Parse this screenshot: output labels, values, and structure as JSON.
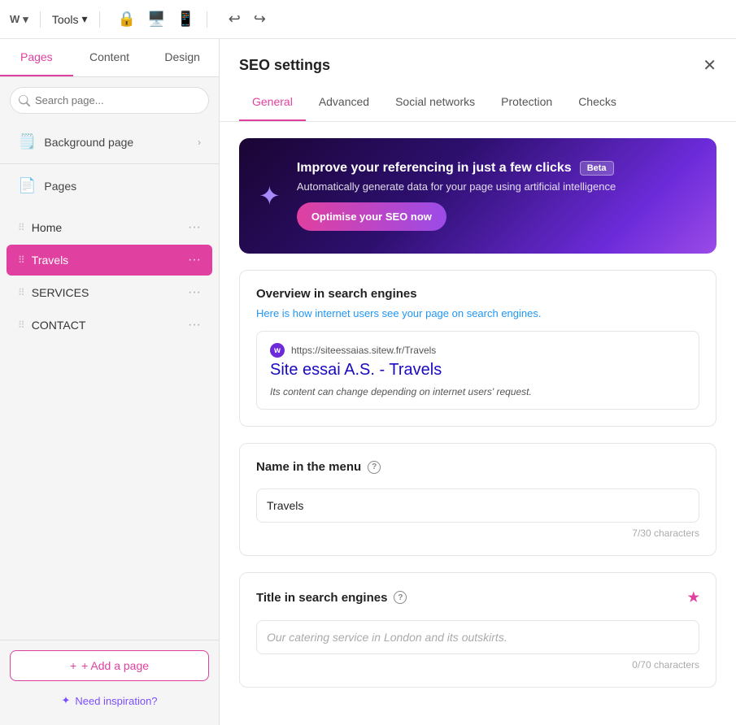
{
  "topbar": {
    "logo": "W",
    "tools_label": "Tools",
    "chevron": "▾"
  },
  "sidebar": {
    "tabs": [
      {
        "label": "Pages",
        "active": true
      },
      {
        "label": "Content",
        "active": false
      },
      {
        "label": "Design",
        "active": false
      }
    ],
    "search_placeholder": "Search page...",
    "background_page_label": "Background page",
    "pages_label": "Pages",
    "nav_items": [
      {
        "name": "Home",
        "active": false
      },
      {
        "name": "Travels",
        "active": true
      },
      {
        "name": "SERVICES",
        "active": false
      },
      {
        "name": "CONTACT",
        "active": false
      }
    ],
    "add_page_label": "+ Add a page",
    "inspiration_label": "Need inspiration?"
  },
  "seo": {
    "title": "SEO settings",
    "tabs": [
      {
        "label": "General",
        "active": true
      },
      {
        "label": "Advanced",
        "active": false
      },
      {
        "label": "Social networks",
        "active": false
      },
      {
        "label": "Protection",
        "active": false
      },
      {
        "label": "Checks",
        "active": false
      }
    ],
    "ai_banner": {
      "title": "Improve your referencing in just a few clicks",
      "badge": "Beta",
      "description": "Automatically generate data for your page using artificial intelligence",
      "button_label": "Optimise your SEO now"
    },
    "overview": {
      "title": "Overview in search engines",
      "subtitle": "Here is how internet users see your page on search engines.",
      "url": "https://siteessaias.sitew.fr/Travels",
      "site_name": "Site essai A.S. - Travels",
      "italic_note": "Its content can change depending on internet users' request."
    },
    "menu_name": {
      "title": "Name in the menu",
      "value": "Travels",
      "char_count": "7/30 characters"
    },
    "title_section": {
      "title": "Title in search engines",
      "placeholder": "Our catering service in London and its outskirts.",
      "char_count": "0/70 characters"
    }
  }
}
